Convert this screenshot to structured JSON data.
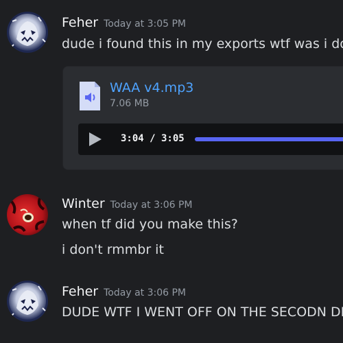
{
  "messages": [
    {
      "username": "Feher",
      "timestamp": "Today at 3:05 PM",
      "lines": [
        "dude i found this in my exports wtf was i doing"
      ],
      "attachment": {
        "file_name": "WAA v4.mp3",
        "file_size": "7.06 MB",
        "time_display": "3:04 / 3:05",
        "progress": 0.995,
        "icon": "audio-file-icon"
      }
    },
    {
      "username": "Winter",
      "timestamp": "Today at 3:06 PM",
      "lines": [
        "when tf did you make this?",
        "i don't rmmbr it"
      ]
    },
    {
      "username": "Feher",
      "timestamp": "Today at 3:06 PM",
      "lines": [
        "DUDE WTF I WENT OFF ON THE SECODN DROP"
      ]
    }
  ],
  "colors": {
    "background": "#1e1f22",
    "username": "#f2f3f5",
    "link": "#4ea3ff",
    "progress": "#5865f2"
  }
}
